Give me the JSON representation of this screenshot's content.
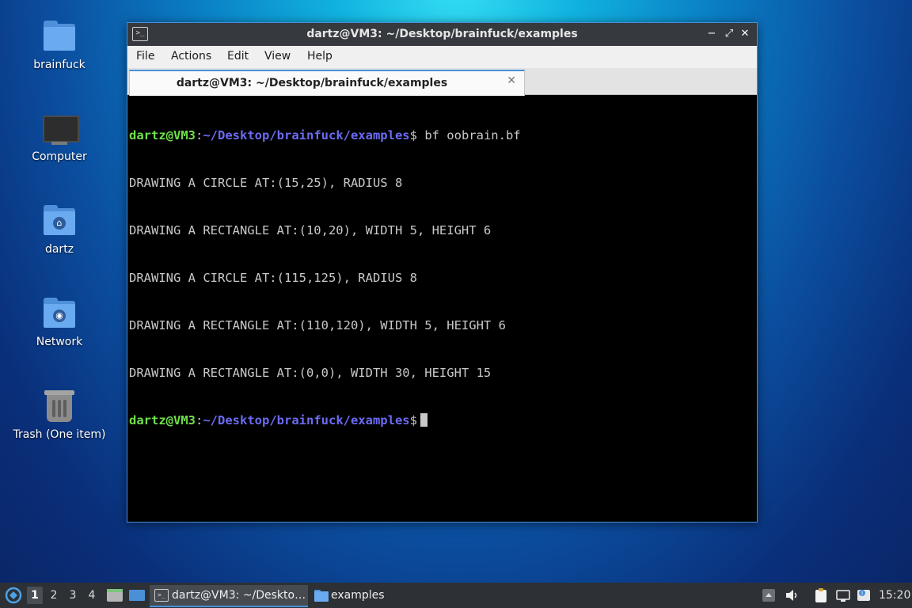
{
  "desktop": {
    "icons": [
      {
        "label": "brainfuck",
        "icon": "folder-icon"
      },
      {
        "label": "Computer",
        "icon": "computer-icon"
      },
      {
        "label": "dartz",
        "icon": "home-folder-icon"
      },
      {
        "label": "Network",
        "icon": "network-folder-icon"
      },
      {
        "label": "Trash (One item)",
        "icon": "trash-icon"
      }
    ]
  },
  "window": {
    "title": "dartz@VM3: ~/Desktop/brainfuck/examples",
    "icon": "terminal-icon",
    "controls": {
      "minimize": "−",
      "maximize": "⤢",
      "close": "✕"
    },
    "menu": [
      "File",
      "Actions",
      "Edit",
      "View",
      "Help"
    ],
    "tab": {
      "title": "dartz@VM3: ~/Desktop/brainfuck/examples",
      "close": "✕"
    }
  },
  "terminal": {
    "prompt_user": "dartz@VM3",
    "prompt_sep": ":",
    "prompt_path": "~/Desktop/brainfuck/examples",
    "prompt_symbol": "$",
    "command": " bf oobrain.bf",
    "output": [
      "DRAWING A CIRCLE AT:(15,25), RADIUS 8",
      "DRAWING A RECTANGLE AT:(10,20), WIDTH 5, HEIGHT 6",
      "DRAWING A CIRCLE AT:(115,125), RADIUS 8",
      "DRAWING A RECTANGLE AT:(110,120), WIDTH 5, HEIGHT 6",
      "DRAWING A RECTANGLE AT:(0,0), WIDTH 30, HEIGHT 15"
    ]
  },
  "taskbar": {
    "workspaces": [
      "1",
      "2",
      "3",
      "4"
    ],
    "active_workspace": "1",
    "tasks": [
      {
        "label": "dartz@VM3: ~/Deskto…",
        "icon": "terminal-icon"
      },
      {
        "label": "examples",
        "icon": "folder-icon"
      }
    ],
    "clock": "15:20"
  },
  "colors": {
    "accent": "#4a90d9",
    "prompt_user": "#6ee04a",
    "prompt_path": "#6b6bf5",
    "terminal_fg": "#c8c8c8",
    "taskbar_bg": "#2d3035"
  }
}
